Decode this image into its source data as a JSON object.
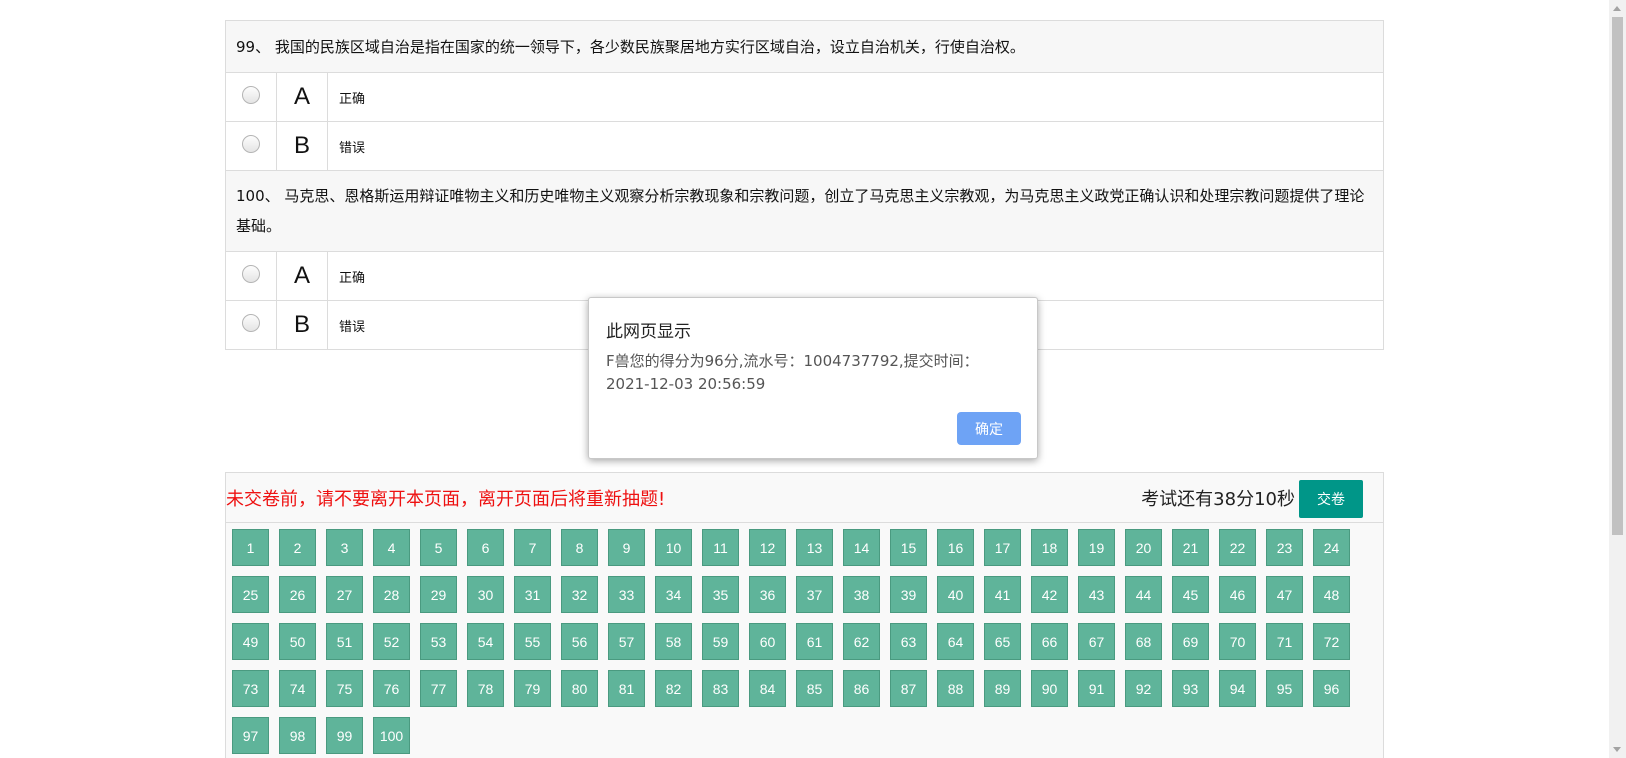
{
  "questions": [
    {
      "number_label": "99、",
      "text": "我国的民族区域自治是指在国家的统一领导下，各少数民族聚居地方实行区域自治，设立自治机关，行使自治权。",
      "options": [
        {
          "letter": "A",
          "text": "正确"
        },
        {
          "letter": "B",
          "text": "错误"
        }
      ]
    },
    {
      "number_label": "100、",
      "text": "马克思、恩格斯运用辩证唯物主义和历史唯物主义观察分析宗教现象和宗教问题，创立了马克思主义宗教观，为马克思主义政党正确认识和处理宗教问题提供了理论基础。",
      "options": [
        {
          "letter": "A",
          "text": "正确"
        },
        {
          "letter": "B",
          "text": "错误"
        }
      ]
    }
  ],
  "answer_card": {
    "warning": "未交卷前，请不要离开本页面，离开页面后将重新抽题!",
    "timer": "考试还有38分10秒",
    "submit_label": "交卷",
    "numbers": [
      "1",
      "2",
      "3",
      "4",
      "5",
      "6",
      "7",
      "8",
      "9",
      "10",
      "11",
      "12",
      "13",
      "14",
      "15",
      "16",
      "17",
      "18",
      "19",
      "20",
      "21",
      "22",
      "23",
      "24",
      "25",
      "26",
      "27",
      "28",
      "29",
      "30",
      "31",
      "32",
      "33",
      "34",
      "35",
      "36",
      "37",
      "38",
      "39",
      "40",
      "41",
      "42",
      "43",
      "44",
      "45",
      "46",
      "47",
      "48",
      "49",
      "50",
      "51",
      "52",
      "53",
      "54",
      "55",
      "56",
      "57",
      "58",
      "59",
      "60",
      "61",
      "62",
      "63",
      "64",
      "65",
      "66",
      "67",
      "68",
      "69",
      "70",
      "71",
      "72",
      "73",
      "74",
      "75",
      "76",
      "77",
      "78",
      "79",
      "80",
      "81",
      "82",
      "83",
      "84",
      "85",
      "86",
      "87",
      "88",
      "89",
      "90",
      "91",
      "92",
      "93",
      "94",
      "95",
      "96",
      "97",
      "98",
      "99",
      "100"
    ]
  },
  "alert": {
    "title": "此网页显示",
    "message": "F兽您的得分为96分,流水号：1004737792,提交时间：2021-12-03 20:56:59",
    "ok_label": "确定"
  },
  "colors": {
    "submit_button": "#009688",
    "number_button": "#5fb49a",
    "warning_text": "#ee1111",
    "alert_ok": "#6ea3f5"
  }
}
